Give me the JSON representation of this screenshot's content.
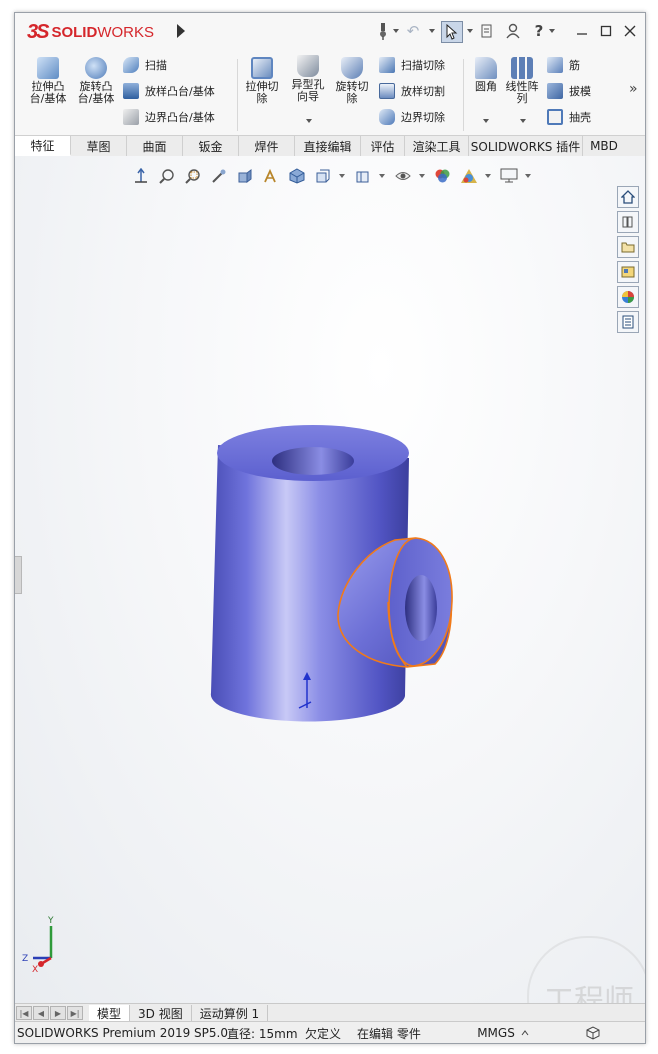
{
  "titlebar": {
    "logo_ds": "3S",
    "logo_bold": "SOLID",
    "logo_light": "WORKS",
    "help_label": "?",
    "window_buttons": [
      "minimize-icon",
      "maximize-icon",
      "close-icon"
    ]
  },
  "ribbon": {
    "extrude_boss": "拉伸凸\n台/基体",
    "revolve_boss": "旋转凸\n台/基体",
    "sweep": "扫描",
    "loft": "放样凸台/基体",
    "boundary": "边界凸台/基体",
    "extrude_cut": "拉伸切\n除",
    "hole_wizard": "异型孔\n向导",
    "revolve_cut": "旋转切\n除",
    "swept_cut": "扫描切除",
    "lofted_cut": "放样切割",
    "boundary_cut": "边界切除",
    "fillet": "圆角",
    "linear_pattern": "线性阵\n列",
    "rib": "筋",
    "draft": "拔模",
    "shell": "抽壳",
    "more": "»"
  },
  "tabs": [
    {
      "label": "特征",
      "active": true
    },
    {
      "label": "草图"
    },
    {
      "label": "曲面"
    },
    {
      "label": "钣金"
    },
    {
      "label": "焊件"
    },
    {
      "label": "直接编辑"
    },
    {
      "label": "评估"
    },
    {
      "label": "渲染工具"
    },
    {
      "label": "SOLIDWORKS 插件"
    },
    {
      "label": "MBD"
    }
  ],
  "bottom_tabs": [
    {
      "label": "模型",
      "active": true
    },
    {
      "label": "3D 视图"
    },
    {
      "label": "运动算例 1"
    }
  ],
  "status": {
    "product": "SOLIDWORKS Premium 2019 SP5.0",
    "measure": "直径: 15mm",
    "state": "欠定义",
    "mode": "在编辑 零件",
    "units": "MMGS"
  },
  "triad": {
    "y": "Y",
    "x": "X",
    "z": "Z"
  },
  "watermark": "工程师",
  "colors": {
    "part_body": "#6c6fd6",
    "selection_edge": "#f07a1a",
    "logo_red": "#d5262b"
  }
}
